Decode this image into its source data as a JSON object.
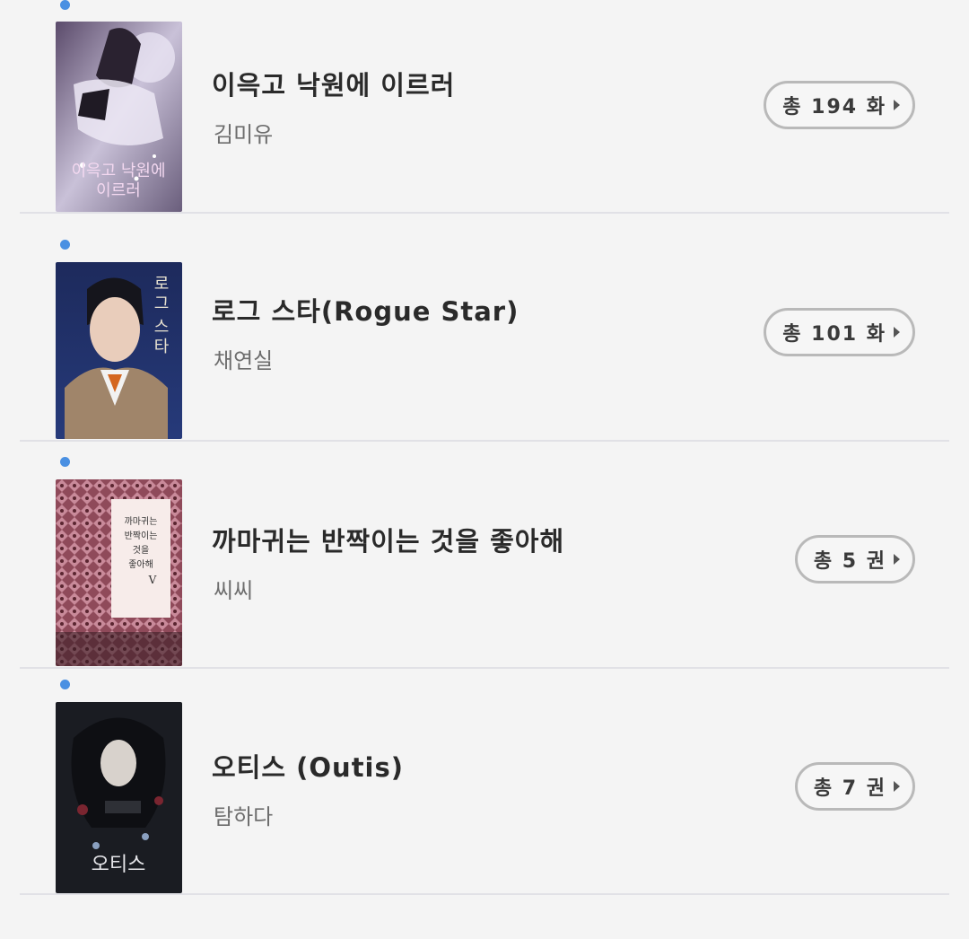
{
  "books": [
    {
      "title": "이윽고 낙원에 이르러",
      "author": "김미유",
      "count_label": "총 194 화",
      "cover_icon": "book-cover-romance-fantasy",
      "cover_text": "이윽고 낙원에 이르러"
    },
    {
      "title": "로그 스타(Rogue Star)",
      "author": "채연실",
      "count_label": "총 101 화",
      "cover_icon": "book-cover-portrait-man",
      "cover_text": "로그 스타"
    },
    {
      "title": "까마귀는 반짝이는 것을 좋아해",
      "author": "씨씨",
      "count_label": "총 5 권",
      "cover_icon": "book-cover-pattern",
      "cover_text": "까마귀는 반짝이는 것을 좋아해 V"
    },
    {
      "title": "오티스 (Outis)",
      "author": "탐하다",
      "count_label": "총 7 권",
      "cover_icon": "book-cover-dark-floral",
      "cover_text": "오티스"
    }
  ],
  "colors": {
    "dot": "#4a90e2",
    "background": "#f4f4f4",
    "divider": "#e1e1e6",
    "pill_border": "#b9b9b9"
  }
}
